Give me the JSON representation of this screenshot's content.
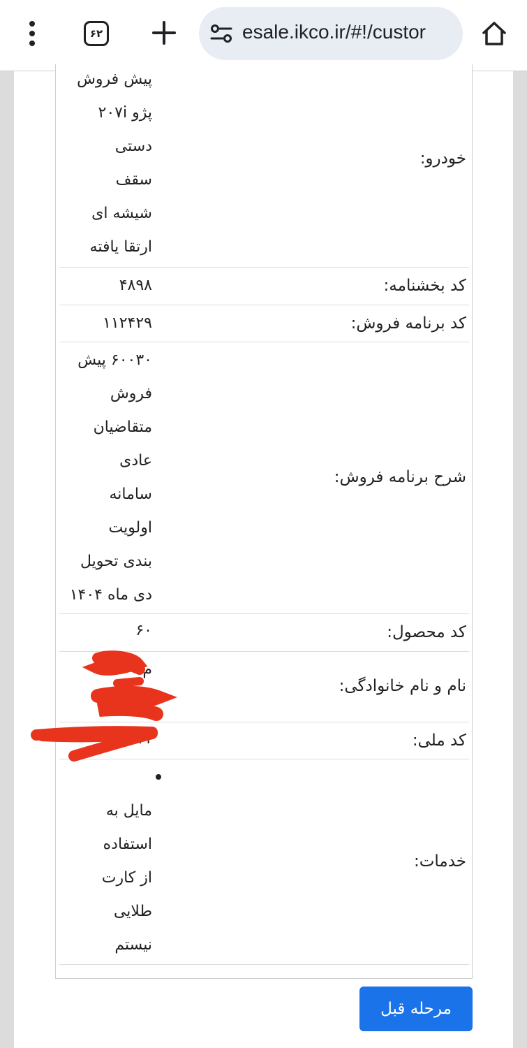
{
  "browser": {
    "tab_count": "۶۲",
    "url": "esale.ikco.ir/#!/custor"
  },
  "rows": {
    "car": {
      "label": "خودرو:",
      "values": [
        "پیش فروش",
        "پژو ۲۰۷i",
        "دستی",
        "سقف",
        "شیشه ای",
        "ارتقا یافته"
      ]
    },
    "circular_code": {
      "label": "کد بخشنامه:",
      "values": [
        "۴۸۹۸"
      ]
    },
    "sale_program_code": {
      "label": "کد برنامه فروش:",
      "values": [
        "۱۱۲۴۲۹"
      ]
    },
    "sale_program_desc": {
      "label": "شرح برنامه فروش:",
      "values": [
        "۶۰۰۳۰ پیش",
        "فروش",
        "متقاضیان",
        "عادی",
        "سامانه",
        "اولویت",
        "بندی تحویل",
        "دی ماه ۱۴۰۴"
      ]
    },
    "product_code": {
      "label": "کد محصول:",
      "values": [
        "۶۰"
      ]
    },
    "full_name": {
      "label": "نام و نام خانوادگی:",
      "values": [
        "م",
        "م"
      ]
    },
    "national_id": {
      "label": "کد ملی:",
      "values": [
        "۱۱۱"
      ]
    },
    "services": {
      "label": "خدمات:",
      "values": [
        "مایل به",
        "استفاده",
        "از کارت",
        "طلایی",
        "نیستم"
      ]
    }
  },
  "buttons": {
    "previous_step": "مرحله قبل"
  },
  "colors": {
    "primary_button": "#1a73e8",
    "redaction": "#e8341c",
    "urlbar": "#e8ecf3"
  },
  "icons": [
    "more-vert-icon",
    "tab-switcher-icon",
    "new-tab-icon",
    "site-settings-icon",
    "home-icon"
  ]
}
